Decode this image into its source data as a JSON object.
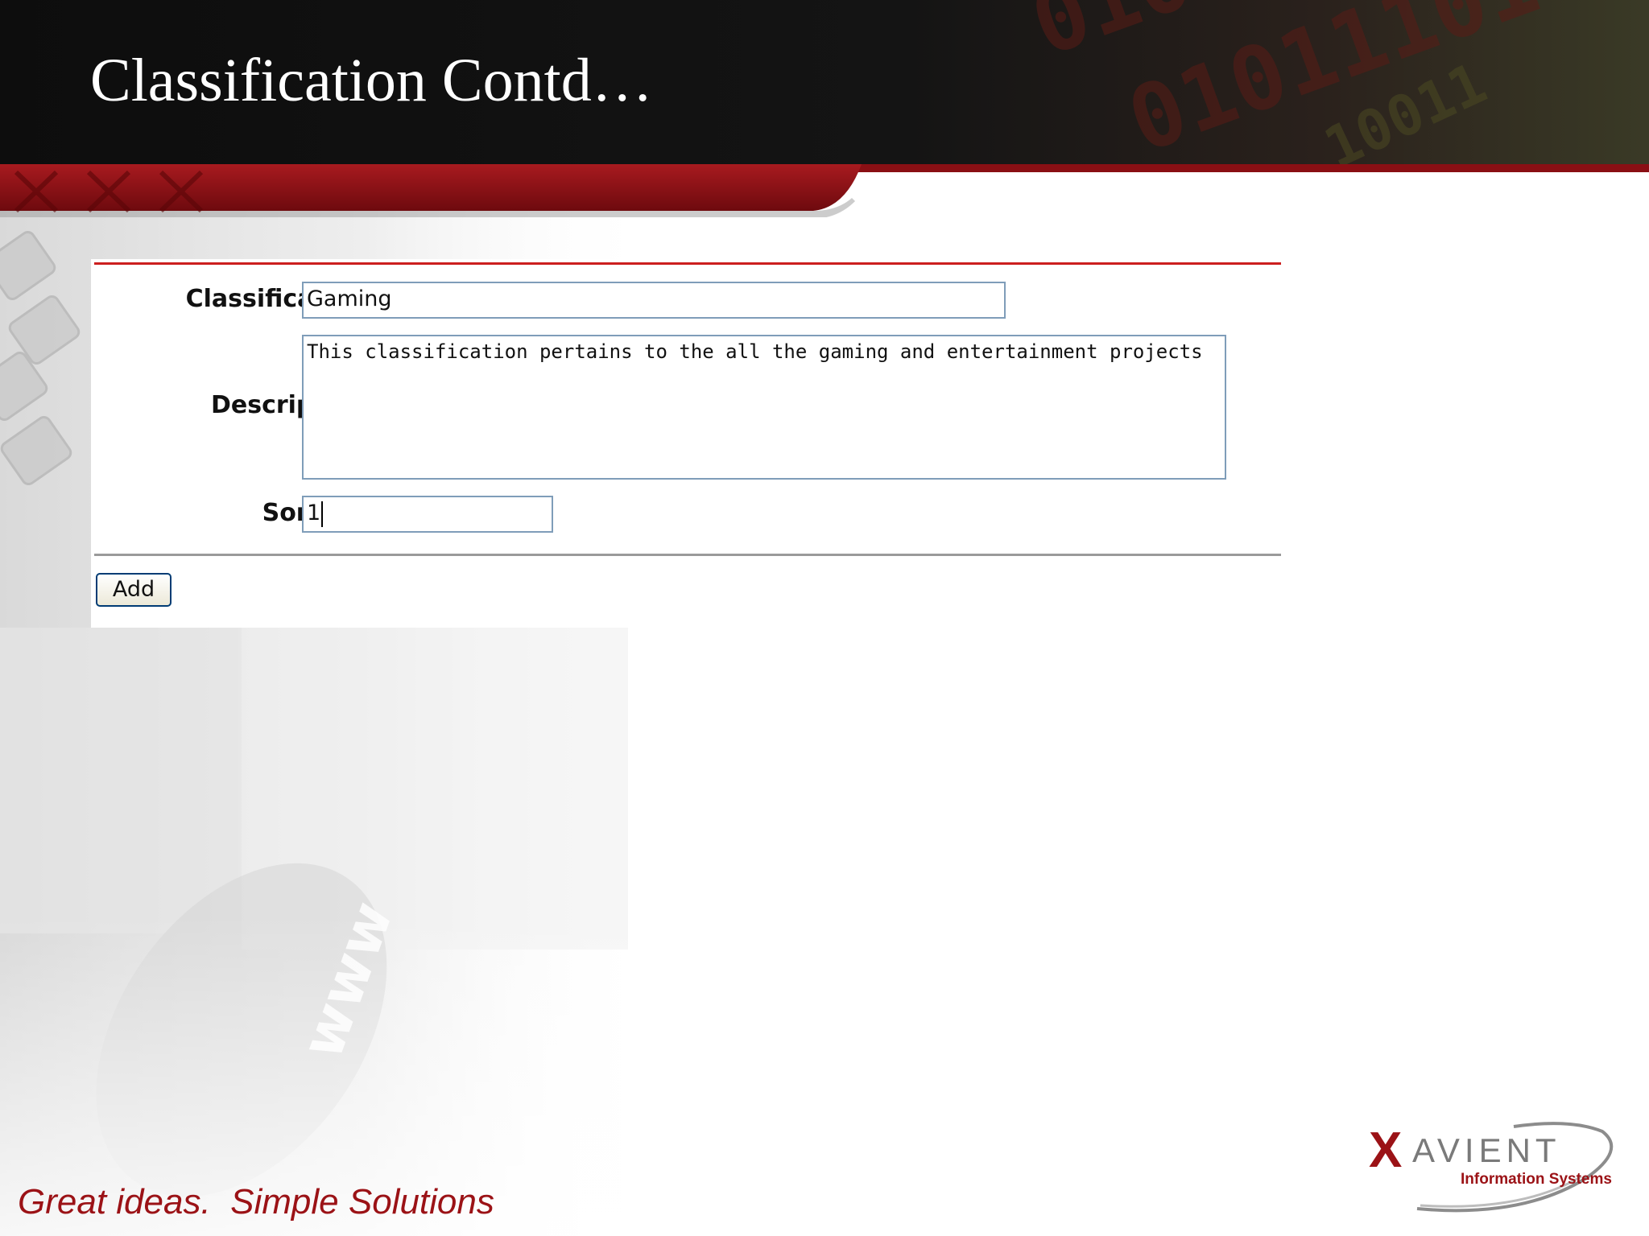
{
  "slide": {
    "title": "Classification Contd…",
    "tagline": "Great ideas.  Simple Solutions"
  },
  "form": {
    "classification_label": "Classification:",
    "classification_value": "Gaming",
    "description_label": "Description:",
    "description_value": "This classification pertains to the all the gaming and entertainment projects",
    "sortkey_label": "Sortkey:",
    "sortkey_value": "1",
    "add_label": "Add"
  },
  "logo": {
    "mark": "X",
    "word": "AVIENT",
    "subtitle": "Information Systems"
  },
  "colors": {
    "header_black": "#0d0d0d",
    "header_red": "#8a0f14",
    "accent_red": "#9b1216",
    "rule_red": "#cc1f1f",
    "input_border": "#7f9db9"
  }
}
